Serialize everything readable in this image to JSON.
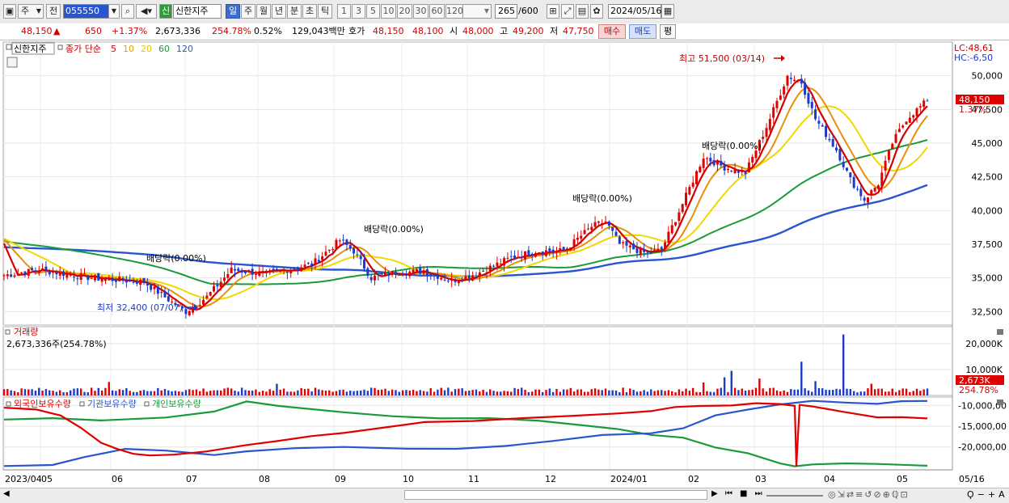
{
  "toolbar": {
    "market": "주",
    "prev": "전",
    "code": "055550",
    "name_badge": "신",
    "name": "신한지주",
    "periods": [
      "일",
      "주",
      "월",
      "년",
      "분",
      "초",
      "틱"
    ],
    "selected_period": "일",
    "intervals": [
      "1",
      "3",
      "5",
      "10",
      "20",
      "30",
      "60",
      "120"
    ],
    "count": "265",
    "count_max": "/600",
    "date": "2024/05/16"
  },
  "quote": {
    "price": "48,150",
    "arrow": "▲",
    "change": "650",
    "change_pct": "+1.37%",
    "volume": "2,673,336",
    "volume_ratio": "254.78%",
    "turnover": "0.52%",
    "amount": "129,043백만",
    "hoga_label": "호가",
    "ask": "48,150",
    "bid": "48,100",
    "open_label": "시",
    "open": "48,000",
    "high_label": "고",
    "high": "49,200",
    "low_label": "저",
    "low": "47,750",
    "buy_label": "매수",
    "sell_label": "매도",
    "eval_label": "평"
  },
  "price_panel": {
    "legend_name": "신한지주",
    "legend_items": [
      {
        "label": "종가 단순",
        "color": "#c00000"
      },
      {
        "label": "5",
        "color": "#d40000"
      },
      {
        "label": "10",
        "color": "#e8a000"
      },
      {
        "label": "20",
        "color": "#e8c800"
      },
      {
        "label": "60",
        "color": "#1a9a3a"
      },
      {
        "label": "120",
        "color": "#2a55d0"
      }
    ],
    "lc": "LC:48,61",
    "hc": "HC:-6,50",
    "current_label": "48,150",
    "current_pct": "1.37%",
    "high_annotation": "최고 51,500 (03/14)",
    "low_annotation": "최저 32,400 (07/07)",
    "div_labels": [
      "배당락(0.00%)",
      "배당락(0.00%)",
      "배당락(0.00%)",
      "배당락(0.00%)"
    ]
  },
  "volume_panel": {
    "title": "거래량",
    "value": "2,673,336주(254.78%)",
    "current_label": "2,673K",
    "current_pct": "254.78%"
  },
  "holdings_panel": {
    "series": [
      {
        "name": "외국인보유수량",
        "color": "#e00000"
      },
      {
        "name": "기관보유수량",
        "color": "#2a55d0"
      },
      {
        "name": "개인보유수량",
        "color": "#1a9a3a"
      }
    ]
  },
  "x_axis_labels": [
    "2023/04",
    "05",
    "06",
    "07",
    "08",
    "09",
    "10",
    "11",
    "12",
    "2024/01",
    "02",
    "03",
    "04",
    "05",
    "05/16"
  ],
  "chart_data": [
    {
      "type": "line",
      "title": "신한지주",
      "y_ticks": [
        32500,
        35000,
        37500,
        40000,
        42500,
        45000,
        47500,
        50000
      ],
      "ylim": [
        31500,
        52500
      ],
      "month_ticks": [
        "2023/04",
        "05",
        "06",
        "07",
        "08",
        "09",
        "10",
        "11",
        "12",
        "2024/01",
        "02",
        "03",
        "04",
        "05"
      ],
      "x_end_label": "05/16",
      "candles_close_monthly": [
        {
          "month": "2023/04",
          "close": 35200
        },
        {
          "month": "05",
          "close": 34900
        },
        {
          "month": "06",
          "close": 34700
        },
        {
          "month": "07",
          "close": 33200
        },
        {
          "month": "08",
          "close": 35600
        },
        {
          "month": "09",
          "close": 37800
        },
        {
          "month": "10",
          "close": 35000
        },
        {
          "month": "11",
          "close": 35200
        },
        {
          "month": "12",
          "close": 37000
        },
        {
          "month": "2024/01",
          "close": 37000
        },
        {
          "month": "02",
          "close": 44000
        },
        {
          "month": "03",
          "close": 49000
        },
        {
          "month": "04",
          "close": 41000
        },
        {
          "month": "05",
          "close": 48150
        }
      ],
      "high": {
        "value": 51500,
        "date": "03/14"
      },
      "low": {
        "value": 32400,
        "date": "07/07"
      },
      "last_close": 48150
    },
    {
      "type": "bar",
      "title": "거래량",
      "y_ticks": [
        10000,
        20000
      ],
      "y_tick_labels": [
        "10,000K",
        "20,000K"
      ],
      "last_value_k": 2673
    },
    {
      "type": "line",
      "title": "외국인보유수량 / 기관보유수량 / 개인보유수량",
      "y_ticks": [
        -10000000,
        -15000000,
        -20000000
      ],
      "y_tick_labels": [
        "-10,000,00",
        "-15,000,00",
        "-20,000,00"
      ],
      "series": [
        {
          "name": "외국인보유수량",
          "start": -10500000,
          "end": -13200000
        },
        {
          "name": "기관보유수량",
          "start": -24500000,
          "end": -8800000
        },
        {
          "name": "개인보유수량",
          "start": -13500000,
          "end": -24500000
        }
      ]
    }
  ]
}
